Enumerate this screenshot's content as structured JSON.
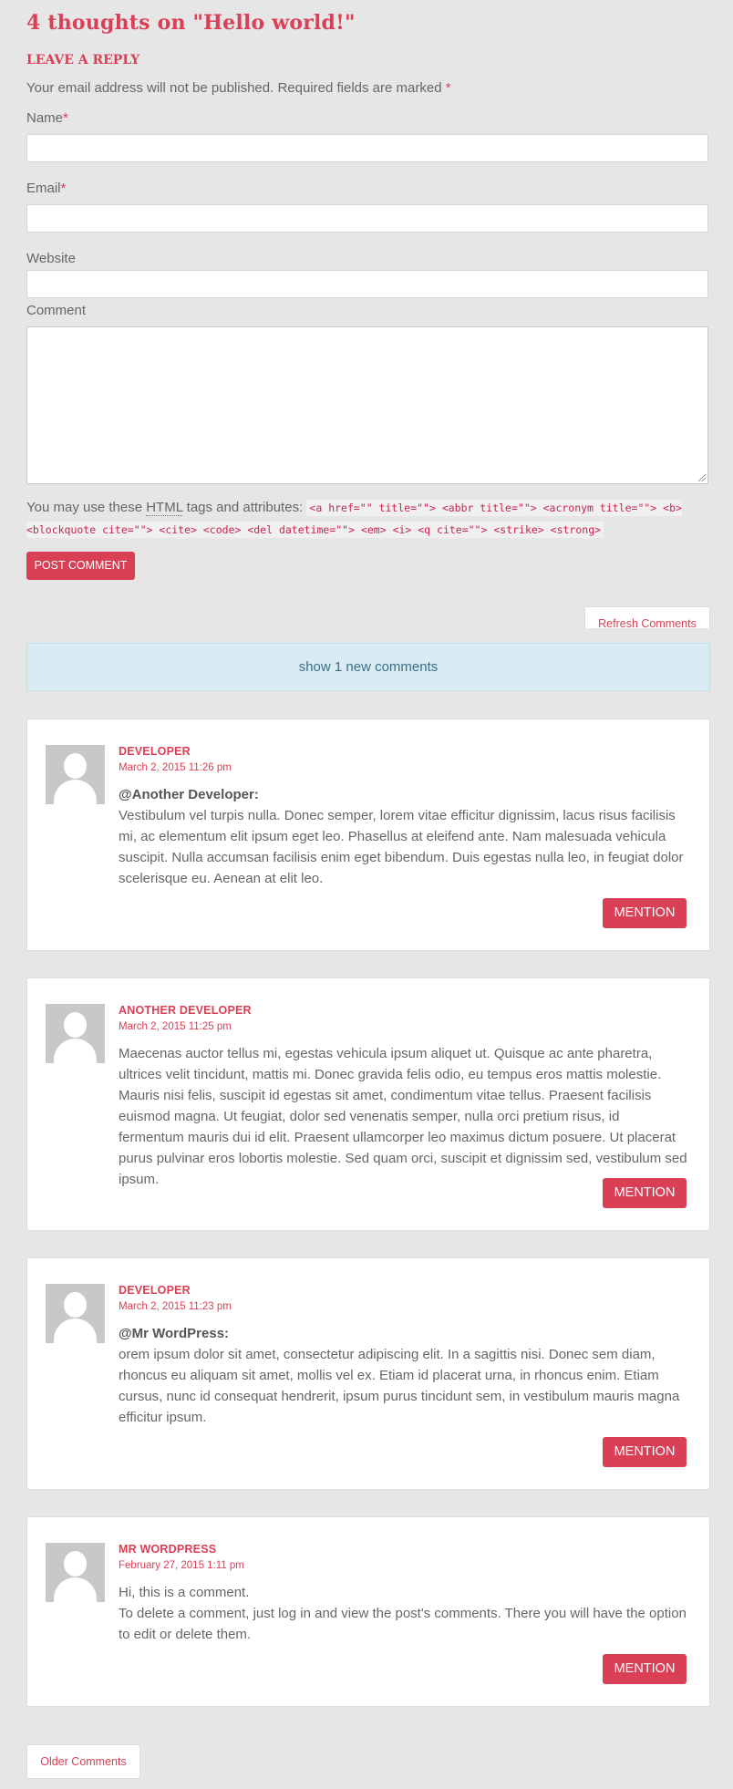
{
  "comments_title": "4 thoughts on \"Hello world!\"",
  "reply": {
    "heading": "LEAVE A REPLY",
    "notes": "Your email address will not be published. Required fields are marked",
    "required_mark": "*",
    "name_label": "Name",
    "email_label": "Email",
    "website_label": "Website",
    "comment_label": "Comment",
    "name_value": "",
    "email_value": "",
    "website_value": "",
    "comment_value": "",
    "allowed_prefix": "You may use these",
    "allowed_abbr": "HTML",
    "allowed_suffix": "tags and attributes:",
    "allowed_tags": "<a href=\"\" title=\"\"> <abbr title=\"\"> <acronym title=\"\"> <b> <blockquote cite=\"\"> <cite> <code> <del datetime=\"\"> <em> <i> <q cite=\"\"> <strike> <strong>",
    "submit_label": "POST COMMENT"
  },
  "refresh_label": "Refresh Comments",
  "new_comments_label": "show 1 new comments",
  "mention_label": "MENTION",
  "comments": [
    {
      "author": "DEVELOPER",
      "date": "March 2, 2015 11:26 pm",
      "mention": "@Another Developer:",
      "text": "Vestibulum vel turpis nulla. Donec semper, lorem vitae efficitur dignissim, lacus risus facilisis mi, ac elementum elit ipsum eget leo. Phasellus at eleifend ante. Nam malesuada vehicula suscipit. Nulla accumsan facilisis enim eget bibendum. Duis egestas nulla leo, in feugiat dolor scelerisque eu. Aenean at elit leo."
    },
    {
      "author": "ANOTHER DEVELOPER",
      "date": "March 2, 2015 11:25 pm",
      "mention": "",
      "text": "Maecenas auctor tellus mi, egestas vehicula ipsum aliquet ut. Quisque ac ante pharetra, ultrices velit tincidunt, mattis mi. Donec gravida felis odio, eu tempus eros mattis molestie. Mauris nisi felis, suscipit id egestas sit amet, condimentum vitae tellus. Praesent facilisis euismod magna. Ut feugiat, dolor sed venenatis semper, nulla orci pretium risus, id fermentum mauris dui id elit. Praesent ullamcorper leo maximus dictum posuere. Ut placerat purus pulvinar eros lobortis molestie. Sed quam orci, suscipit et dignissim sed, vestibulum sed ipsum."
    },
    {
      "author": "DEVELOPER",
      "date": "March 2, 2015 11:23 pm",
      "mention": "@Mr WordPress:",
      "text": "orem ipsum dolor sit amet, consectetur adipiscing elit. In a sagittis nisi. Donec sem diam, rhoncus eu aliquam sit amet, mollis vel ex. Etiam id placerat urna, in rhoncus enim. Etiam cursus, nunc id consequat hendrerit, ipsum purus tincidunt sem, in vestibulum mauris magna efficitur ipsum."
    },
    {
      "author": "MR WORDPRESS",
      "date": "February 27, 2015 1:11 pm",
      "mention": "",
      "text": "Hi, this is a comment.",
      "text2": "To delete a comment, just log in and view the post's comments. There you will have the option to edit or delete them."
    }
  ],
  "older_comments_label": "Older Comments",
  "colors": {
    "accent": "#d94055",
    "background": "#e6e6e6",
    "notice_bg": "#d9ecf3"
  }
}
